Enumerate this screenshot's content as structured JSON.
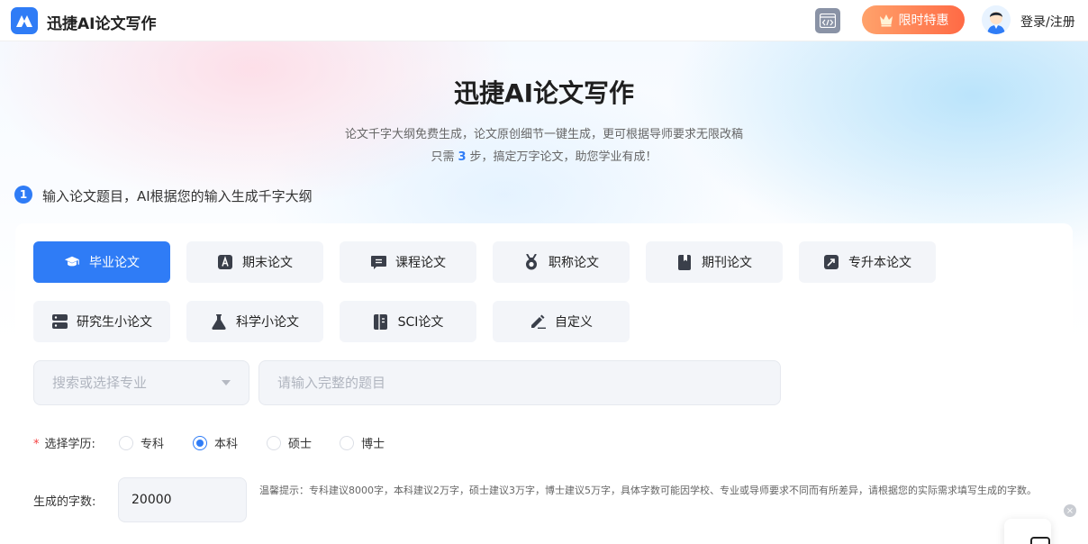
{
  "header": {
    "brand": "迅捷AI论文写作",
    "promo_label": "限时特惠",
    "login_label": "登录/注册"
  },
  "hero": {
    "title": "迅捷AI论文写作",
    "subtitle_line1": "论文千字大纲免费生成，论文原创细节一键生成，更可根据导师要求无限改稿",
    "subtitle_line2_prefix": "只需",
    "subtitle_line2_num": "3",
    "subtitle_line2_suffix": "步，搞定万字论文，助您学业有成！"
  },
  "step": {
    "number": "1",
    "text": "输入论文题目，AI根据您的输入生成千字大纲"
  },
  "paper_types": [
    {
      "label": "毕业论文",
      "icon": "graduation-cap-icon",
      "active": true
    },
    {
      "label": "期末论文",
      "icon": "letter-a-icon",
      "active": false
    },
    {
      "label": "课程论文",
      "icon": "notebook-icon",
      "active": false
    },
    {
      "label": "职称论文",
      "icon": "medal-icon",
      "active": false
    },
    {
      "label": "期刊论文",
      "icon": "journal-icon",
      "active": false
    },
    {
      "label": "专升本论文",
      "icon": "upgrade-icon",
      "active": false
    },
    {
      "label": "研究生小论文",
      "icon": "server-icon",
      "active": false
    },
    {
      "label": "科学小论文",
      "icon": "flask-icon",
      "active": false
    },
    {
      "label": "SCI论文",
      "icon": "document-icon",
      "active": false
    },
    {
      "label": "自定义",
      "icon": "pen-icon",
      "active": false
    }
  ],
  "form": {
    "major_placeholder": "搜索或选择专业",
    "topic_placeholder": "请输入完整的题目",
    "degree_label": "选择学历:",
    "degrees": [
      {
        "label": "专科",
        "checked": false
      },
      {
        "label": "本科",
        "checked": true
      },
      {
        "label": "硕士",
        "checked": false
      },
      {
        "label": "博士",
        "checked": false
      }
    ],
    "word_count_label": "生成的字数:",
    "word_count_value": "20000",
    "tip": "温馨提示：专科建议8000字，本科建议2万字，硕士建议3万字，博士建议5万字，具体字数可能因学校、专业或导师要求不同而有所差异，请根据您的实际需求填写生成的字数。"
  },
  "colors": {
    "accent": "#2f7cf6",
    "promo_start": "#ffa26b",
    "promo_end": "#ff6a45",
    "required": "#f53f3f"
  }
}
